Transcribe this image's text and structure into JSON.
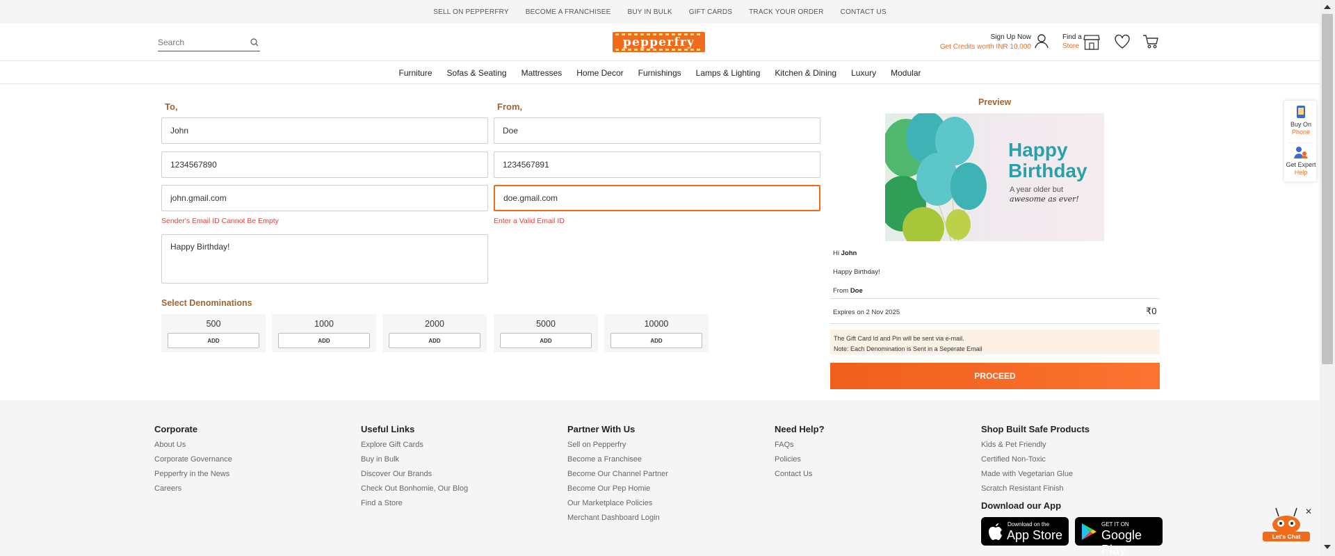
{
  "topbar": {
    "links": [
      "SELL ON PEPPERFRY",
      "BECOME A FRANCHISEE",
      "BUY IN BULK",
      "GIFT CARDS",
      "TRACK YOUR ORDER",
      "CONTACT US"
    ]
  },
  "header": {
    "search_placeholder": "Search",
    "logo": "pepperfry",
    "signup_label": "Sign Up Now",
    "credits_label": "Get Credits worth INR 10,000",
    "find_label": "Find a",
    "store_label": "Store"
  },
  "categories": [
    "Furniture",
    "Sofas & Seating",
    "Mattresses",
    "Home Decor",
    "Furnishings",
    "Lamps & Lighting",
    "Kitchen & Dining",
    "Luxury",
    "Modular"
  ],
  "form": {
    "to_label": "To,",
    "from_label": "From,",
    "to_name": "John",
    "from_name": "Doe",
    "to_phone": "1234567890",
    "from_phone": "1234567891",
    "to_email": "john.gmail.com",
    "from_email": "doe.gmail.com",
    "to_error": "Sender's Email ID Cannot Be Empty",
    "from_error": "Enter a Valid Email ID",
    "message": "Happy Birthday!",
    "denom_title": "Select Denominations",
    "denominations": [
      {
        "value": "500",
        "button": "ADD"
      },
      {
        "value": "1000",
        "button": "ADD"
      },
      {
        "value": "2000",
        "button": "ADD"
      },
      {
        "value": "5000",
        "button": "ADD"
      },
      {
        "value": "10000",
        "button": "ADD"
      }
    ]
  },
  "preview": {
    "title": "Preview",
    "card_title_1": "Happy",
    "card_title_2": "Birthday",
    "card_sub_1": "A year older but",
    "card_sub_2": "awesome as ever!",
    "hi_prefix": "Hi",
    "hi_name": "John",
    "message": "Happy Birthday!",
    "from_prefix": "From",
    "from_name": "Doe",
    "expires": "Expires on 2 Nov 2025",
    "amount": "₹0",
    "note_1": "The Gift Card Id and Pin will be sent via e-mail.",
    "note_2": "Note: Each Denomination is Sent in a Seperate Email",
    "proceed": "PROCEED"
  },
  "sidewidget": {
    "buy_on": "Buy On",
    "phone": "Phone",
    "get_expert": "Get Expert",
    "help": "Help"
  },
  "footer": {
    "columns": [
      {
        "title": "Corporate",
        "links": [
          "About Us",
          "Corporate Governance",
          "Pepperfry in the News",
          "Careers"
        ]
      },
      {
        "title": "Useful Links",
        "links": [
          "Explore Gift Cards",
          "Buy in Bulk",
          "Discover Our Brands",
          "Check Out Bonhomie, Our Blog",
          "Find a Store"
        ]
      },
      {
        "title": "Partner With Us",
        "links": [
          "Sell on Pepperfry",
          "Become a Franchisee",
          "Become Our Channel Partner",
          "Become Our Pep Homie",
          "Our Marketplace Policies",
          "Merchant Dashboard Login"
        ]
      },
      {
        "title": "Need Help?",
        "links": [
          "FAQs",
          "Policies",
          "Contact Us"
        ]
      },
      {
        "title": "Shop Built Safe Products",
        "links": [
          "Kids & Pet Friendly",
          "Certified Non-Toxic",
          "Made with Vegetarian Glue",
          "Scratch Resistant Finish"
        ]
      }
    ],
    "download_title": "Download our App",
    "appstore_small": "Download on the",
    "appstore_big": "App Store",
    "playstore_small": "GET IT ON",
    "playstore_big": "Google Play"
  },
  "chat": {
    "label": "Let's Chat",
    "close": "✕"
  },
  "colors": {
    "accent": "#f06b1c",
    "label_brown": "#a4642e",
    "error": "#e0413d",
    "teal": "#2aa0a8"
  }
}
